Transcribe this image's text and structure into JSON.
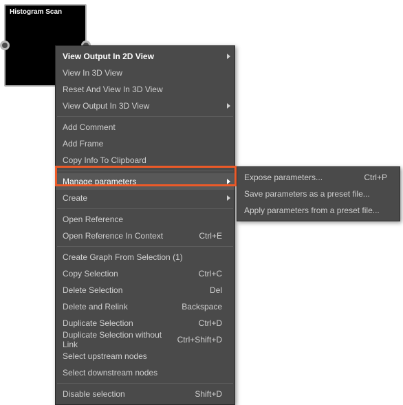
{
  "node": {
    "title": "Histogram Scan"
  },
  "menu": {
    "items": [
      {
        "label": "View Output In 2D View",
        "bold": true,
        "arrow": true
      },
      {
        "label": "View In 3D View"
      },
      {
        "label": "Reset And View In 3D View"
      },
      {
        "label": "View Output In 3D View",
        "arrow": true
      }
    ],
    "items2": [
      {
        "label": "Add Comment"
      },
      {
        "label": "Add Frame"
      },
      {
        "label": "Copy Info To Clipboard"
      }
    ],
    "manage": {
      "label": "Manage parameters"
    },
    "items3": [
      {
        "label": "Create",
        "arrow": true
      }
    ],
    "items4": [
      {
        "label": "Open Reference"
      },
      {
        "label": "Open Reference In Context",
        "shortcut": "Ctrl+E"
      }
    ],
    "items5": [
      {
        "label": "Create Graph From Selection (1)"
      },
      {
        "label": "Copy Selection",
        "shortcut": "Ctrl+C"
      },
      {
        "label": "Delete Selection",
        "shortcut": "Del"
      },
      {
        "label": "Delete and Relink",
        "shortcut": "Backspace"
      },
      {
        "label": "Duplicate Selection",
        "shortcut": "Ctrl+D"
      },
      {
        "label": "Duplicate Selection without Link",
        "shortcut": "Ctrl+Shift+D"
      },
      {
        "label": "Select upstream nodes"
      },
      {
        "label": "Select downstream nodes"
      }
    ],
    "items6": [
      {
        "label": "Disable selection",
        "shortcut": "Shift+D"
      }
    ]
  },
  "submenu": {
    "items": [
      {
        "label": "Expose parameters...",
        "shortcut": "Ctrl+P"
      },
      {
        "label": "Save parameters as a preset file..."
      },
      {
        "label": "Apply parameters from a preset file..."
      }
    ]
  }
}
